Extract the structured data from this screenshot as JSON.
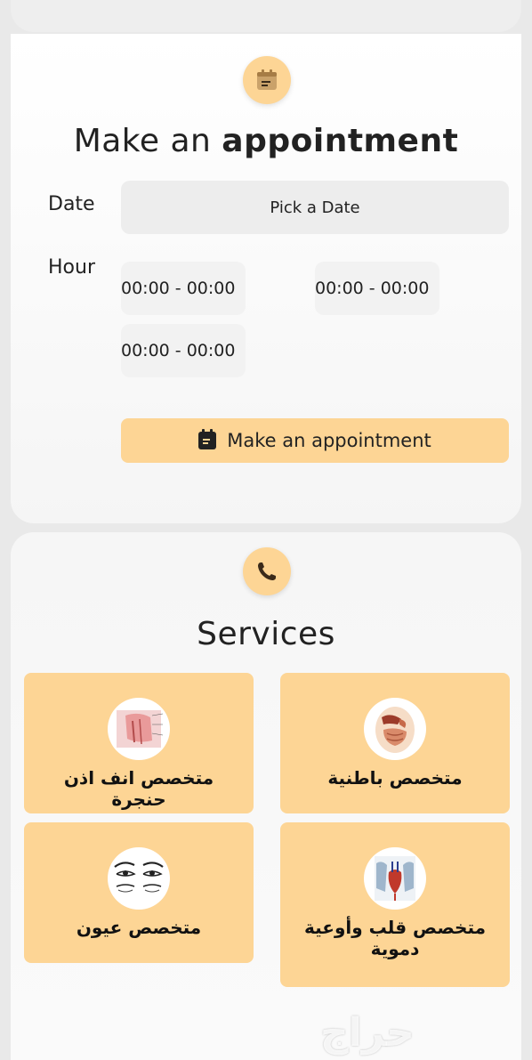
{
  "appointment": {
    "title_light": "Make an",
    "title_bold": "appointment",
    "date_label": "Date",
    "date_placeholder": "Pick a Date",
    "hour_label": "Hour",
    "slots": [
      "00:00 - 00:00",
      "00:00 - 00:00",
      "00:00 - 00:00"
    ],
    "button_label": "Make an appointment"
  },
  "services": {
    "title": "Services",
    "items": [
      {
        "name": "متخصص انف اذن حنجرة",
        "image": "ent-anatomy"
      },
      {
        "name": "متخصص باطنية",
        "image": "digestive-anatomy"
      },
      {
        "name": "متخصص عيون",
        "image": "eyes-drawing"
      },
      {
        "name": "متخصص قلب وأوعية دموية",
        "image": "heart-vessels-anatomy"
      }
    ]
  },
  "watermark": "حراج",
  "colors": {
    "accent": "#fdd595",
    "text": "#222222"
  }
}
